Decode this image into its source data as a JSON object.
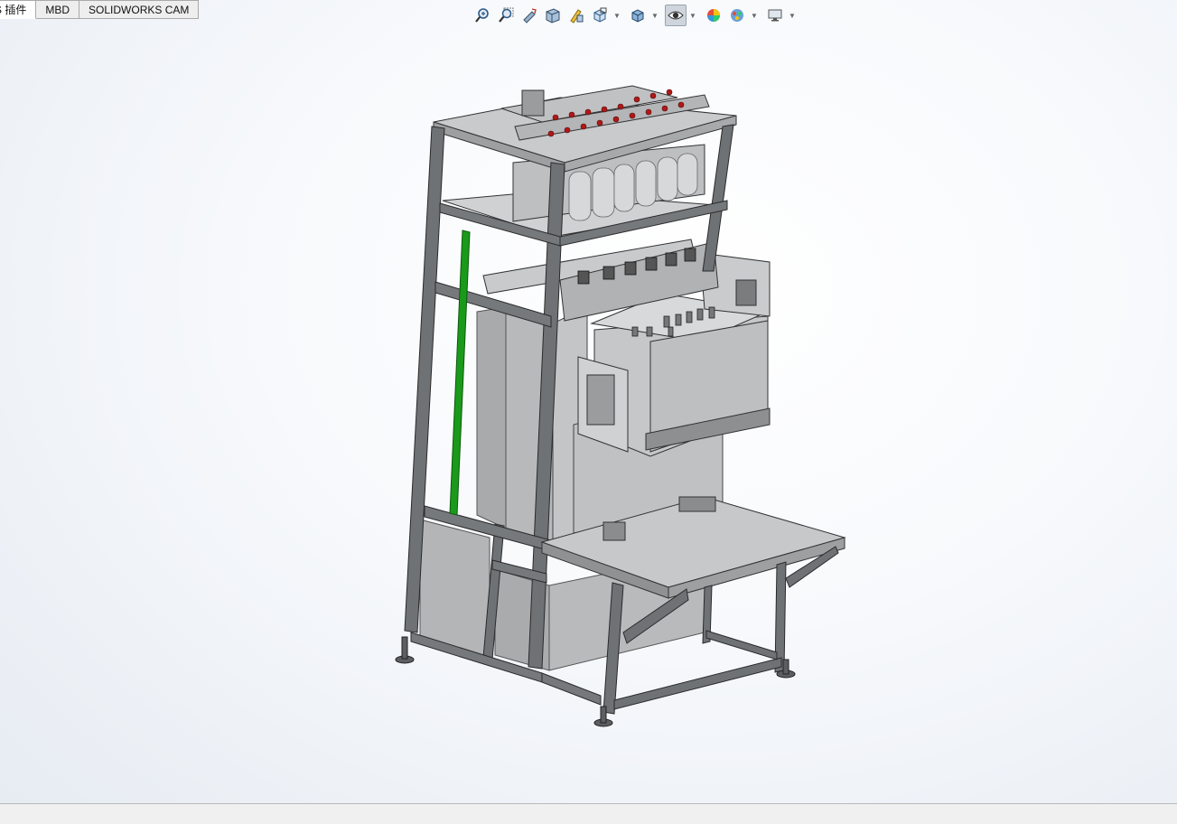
{
  "tabs": [
    {
      "label": "S 插件",
      "active": true
    },
    {
      "label": "MBD",
      "active": false
    },
    {
      "label": "SOLIDWORKS CAM",
      "active": false
    }
  ],
  "view_toolbar": {
    "buttons": [
      {
        "icon": "zoom-to-fit-icon"
      },
      {
        "icon": "zoom-to-area-icon"
      },
      {
        "icon": "previous-view-icon"
      },
      {
        "icon": "section-view-icon"
      },
      {
        "icon": "dynamic-annotation-views-icon"
      },
      {
        "icon": "view-orientation-icon",
        "dropdown": true
      },
      {
        "icon": "display-style-icon",
        "dropdown": true
      },
      {
        "icon": "hide-show-items-icon",
        "dropdown": true,
        "pressed": true
      },
      {
        "icon": "edit-appearance-icon"
      },
      {
        "icon": "apply-scene-icon",
        "dropdown": true
      },
      {
        "icon": "view-settings-icon",
        "dropdown": true
      }
    ]
  },
  "status_bar": {
    "text": ""
  },
  "colors": {
    "frame": "#6e7275",
    "panel": "#b5b7b9",
    "sheet": "#c9cacc",
    "accent_green": "#1a9a1a",
    "accent_red": "#b01818"
  }
}
